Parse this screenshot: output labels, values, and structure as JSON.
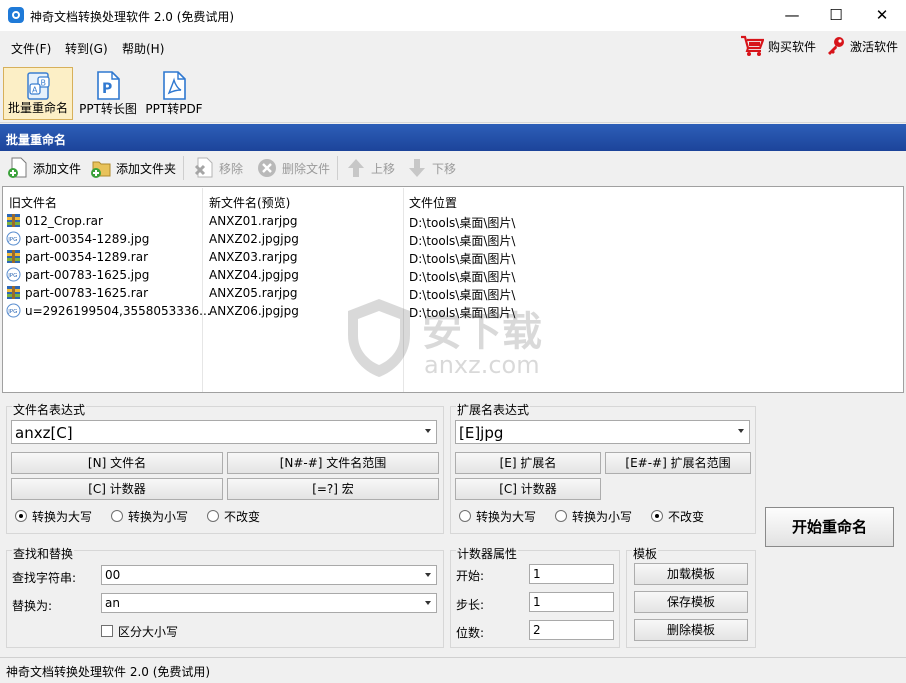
{
  "window": {
    "title": "神奇文档转换处理软件 2.0 (免费试用)",
    "min_glyph": "—",
    "max_glyph": "☐",
    "close_glyph": "✕"
  },
  "menu": {
    "items": [
      "文件(F)",
      "转到(G)",
      "帮助(H)"
    ],
    "buy": "购买软件",
    "activate": "激活软件"
  },
  "toolbar": {
    "tools": [
      "批量重命名",
      "PPT转长图",
      "PPT转PDF"
    ]
  },
  "section": {
    "title": "批量重命名"
  },
  "filebar": {
    "add_file": "添加文件",
    "add_folder": "添加文件夹",
    "remove": "移除",
    "delete": "删除文件",
    "up": "上移",
    "down": "下移"
  },
  "list": {
    "headers": [
      "旧文件名",
      "新文件名(预览)",
      "文件位置"
    ],
    "rows": [
      {
        "type": "rar",
        "old": "012_Crop.rar",
        "new": "ANXZ01.rarjpg",
        "path": "D:\\tools\\桌面\\图片\\"
      },
      {
        "type": "jpg",
        "old": "part-00354-1289.jpg",
        "new": "ANXZ02.jpgjpg",
        "path": "D:\\tools\\桌面\\图片\\"
      },
      {
        "type": "rar",
        "old": "part-00354-1289.rar",
        "new": "ANXZ03.rarjpg",
        "path": "D:\\tools\\桌面\\图片\\"
      },
      {
        "type": "jpg",
        "old": "part-00783-1625.jpg",
        "new": "ANXZ04.jpgjpg",
        "path": "D:\\tools\\桌面\\图片\\"
      },
      {
        "type": "rar",
        "old": "part-00783-1625.rar",
        "new": "ANXZ05.rarjpg",
        "path": "D:\\tools\\桌面\\图片\\"
      },
      {
        "type": "jpg",
        "old": "u=2926199504,3558053336...",
        "new": "ANXZ06.jpgjpg",
        "path": "D:\\tools\\桌面\\图片\\"
      }
    ]
  },
  "filename_expr": {
    "label": "文件名表达式",
    "value": "anxz[C]",
    "btn_name": "[N] 文件名",
    "btn_range": "[N#-#] 文件名范围",
    "btn_counter": "[C] 计数器",
    "btn_macro": "[=?] 宏",
    "radio_upper": "转换为大写",
    "radio_lower": "转换为小写",
    "radio_keep": "不改变",
    "selected": "upper"
  },
  "ext_expr": {
    "label": "扩展名表达式",
    "value": "[E]jpg",
    "btn_ext": "[E] 扩展名",
    "btn_range": "[E#-#] 扩展名范围",
    "btn_counter": "[C] 计数器",
    "radio_upper": "转换为大写",
    "radio_lower": "转换为小写",
    "radio_keep": "不改变",
    "selected": "keep"
  },
  "find_replace": {
    "label": "查找和替换",
    "find_label": "查找字符串:",
    "find_value": "00",
    "replace_label": "替换为:",
    "replace_value": "an",
    "case_label": "区分大小写",
    "case_checked": false
  },
  "counter": {
    "label": "计数器属性",
    "start_label": "开始:",
    "start": "1",
    "step_label": "步长:",
    "step": "1",
    "digits_label": "位数:",
    "digits": "2"
  },
  "template": {
    "label": "模板",
    "load": "加载模板",
    "save": "保存模板",
    "delete": "删除模板"
  },
  "start_button": "开始重命名",
  "statusbar": "神奇文档转换处理软件 2.0 (免费试用)",
  "watermark": {
    "cn": "安下载",
    "en": "anxz.com"
  }
}
